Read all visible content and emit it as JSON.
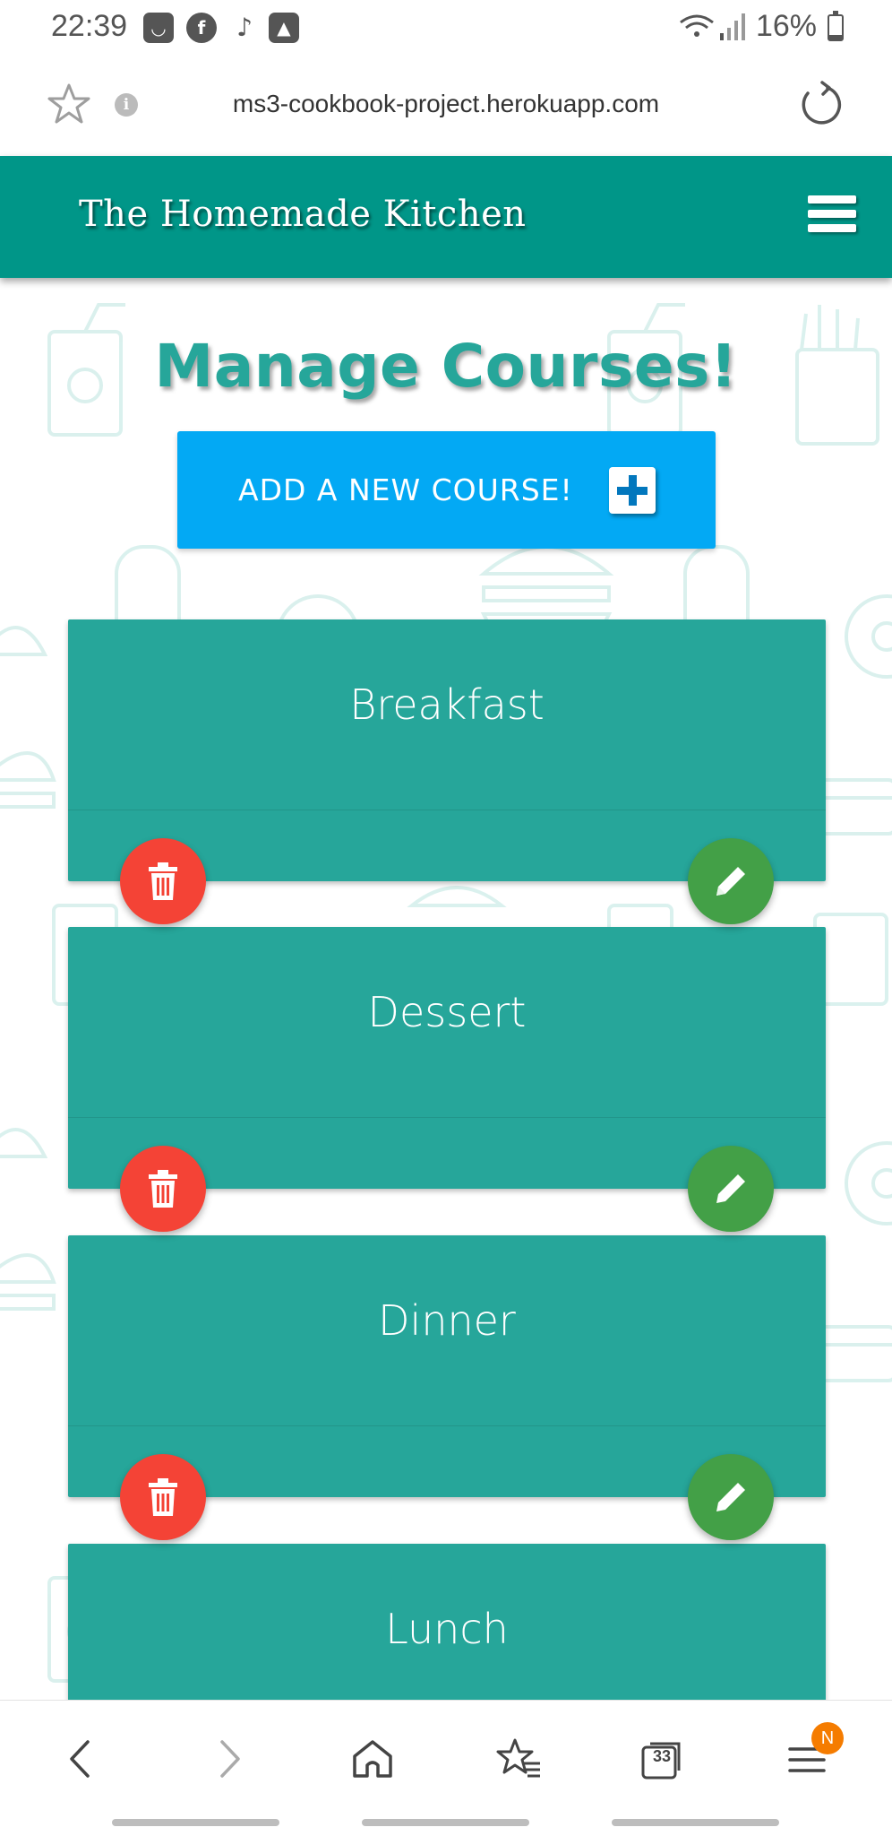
{
  "status_bar": {
    "time": "22:39",
    "notification_icons": [
      "bag-icon",
      "facebook-icon",
      "tiktok-icon",
      "gallery-icon"
    ],
    "battery_text": "16%",
    "battery_level": 0.16
  },
  "browser": {
    "url": "ms3-cookbook-project.herokuapp.com",
    "info_glyph": "i",
    "tabs_count": "33",
    "menu_badge": "N"
  },
  "header": {
    "brand": "The Homemade Kitchen",
    "color": "#009688"
  },
  "page": {
    "title": "Manage Courses!",
    "add_button_label": "ADD A NEW COURSE!"
  },
  "courses": [
    {
      "name": "Breakfast"
    },
    {
      "name": "Dessert"
    },
    {
      "name": "Dinner"
    },
    {
      "name": "Lunch"
    }
  ],
  "colors": {
    "card": "#26a69a",
    "add_button": "#03a9f4",
    "delete": "#f44336",
    "edit": "#43a047"
  }
}
